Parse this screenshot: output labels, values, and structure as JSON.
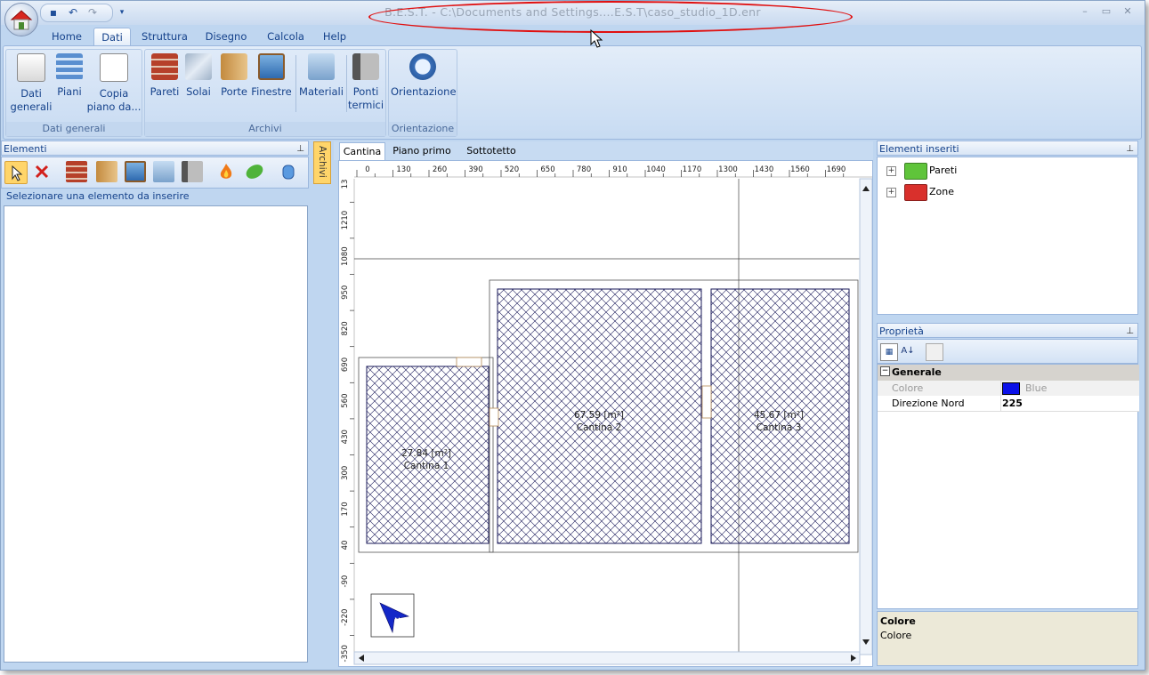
{
  "title_bar": {
    "title": "B.E.S.T. - C:\\Documents and Settings.…E.S.T\\caso_studio_1D.enr",
    "minimize": "–",
    "restore": "▭",
    "close": "✕"
  },
  "quick_access": {
    "save": "▪",
    "undo": "↶",
    "redo": "↷",
    "more": "▾"
  },
  "menu_tabs": [
    {
      "label": "Home"
    },
    {
      "label": "Dati"
    },
    {
      "label": "Struttura"
    },
    {
      "label": "Disegno"
    },
    {
      "label": "Calcola"
    },
    {
      "label": "Help"
    }
  ],
  "ribbon": {
    "groups": [
      {
        "label": "Dati generali",
        "buttons": [
          {
            "label_1": "Dati",
            "label_2": "generali"
          },
          {
            "label_1": "Piani",
            "label_2": ""
          },
          {
            "label_1": "Copia",
            "label_2": "piano da..."
          }
        ]
      },
      {
        "label": "Archivi",
        "buttons": [
          {
            "label_1": "Pareti",
            "label_2": ""
          },
          {
            "label_1": "Solai",
            "label_2": ""
          },
          {
            "label_1": "Porte",
            "label_2": ""
          },
          {
            "label_1": "Finestre",
            "label_2": ""
          },
          {
            "label_1": "Materiali",
            "label_2": ""
          },
          {
            "label_1": "Ponti",
            "label_2": "termici"
          }
        ]
      },
      {
        "label": "Orientazione",
        "buttons": [
          {
            "label_1": "Orientazione",
            "label_2": ""
          }
        ]
      }
    ]
  },
  "left_panel": {
    "title": "Elementi",
    "pin": "📌",
    "hint": "Selezionare una elemento da inserire",
    "side_tab": "Archivi"
  },
  "document_tabs": [
    {
      "label": "Cantina"
    },
    {
      "label": "Piano primo"
    },
    {
      "label": "Sottotetto"
    }
  ],
  "canvas": {
    "ruler_x": [
      "0",
      "130",
      "260",
      "390",
      "520",
      "650",
      "780",
      "910",
      "1040",
      "1170",
      "1300",
      "1430",
      "1560",
      "1690"
    ],
    "ruler_y": [
      "13",
      "1210",
      "1080",
      "950",
      "820",
      "690",
      "560",
      "430",
      "300",
      "170",
      "40",
      "-90",
      "-220",
      "-350"
    ],
    "rooms": [
      {
        "area": "27.84 [m²]",
        "name": "Cantina 1"
      },
      {
        "area": "67.59 [m²]",
        "name": "Cantina 2"
      },
      {
        "area": "45.67 [m²]",
        "name": "Cantina 3"
      }
    ],
    "north_label": "N"
  },
  "right_tree": {
    "title": "Elementi inseriti",
    "items": [
      {
        "label": "Pareti",
        "color": "#5fc43a"
      },
      {
        "label": "Zone",
        "color": "#d9302c"
      }
    ]
  },
  "properties": {
    "title": "Proprietà",
    "section": "Generale",
    "rows": [
      {
        "name": "Colore",
        "value": "Blue",
        "swatch": "#0a10e8"
      },
      {
        "name": "Direzione Nord",
        "value": "225"
      }
    ],
    "help_title": "Colore",
    "help_text": "Colore"
  }
}
